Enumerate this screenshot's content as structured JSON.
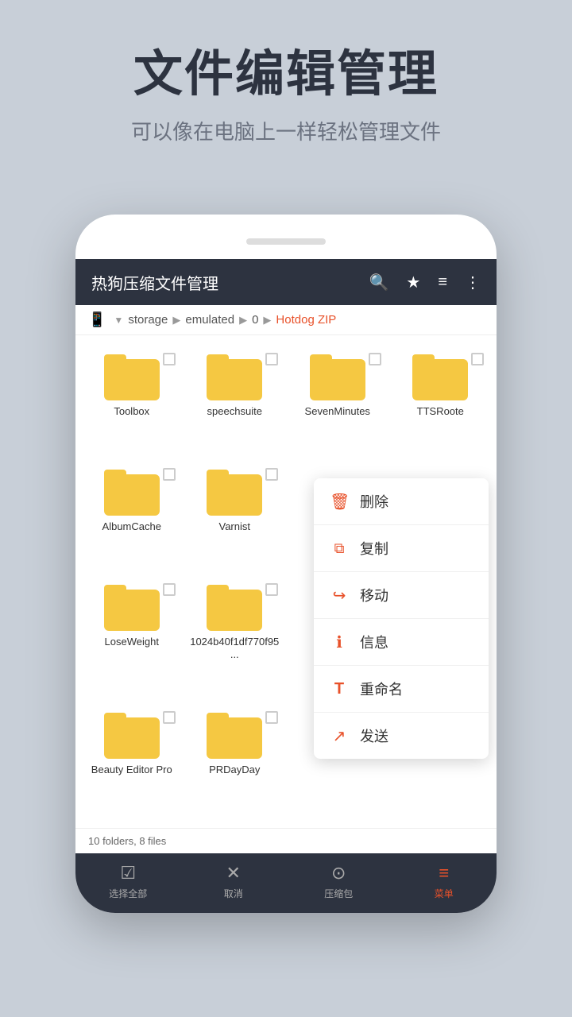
{
  "page": {
    "background": "#c8cfd8"
  },
  "header": {
    "main_title": "文件编辑管理",
    "sub_title": "可以像在电脑上一样轻松管理文件"
  },
  "appbar": {
    "title": "热狗压缩文件管理",
    "icons": [
      "search",
      "star",
      "menu",
      "more"
    ]
  },
  "breadcrumb": {
    "device": "📱",
    "path": [
      "storage",
      "emulated",
      "0"
    ],
    "highlight": "Hotdog ZIP"
  },
  "files": [
    {
      "name": "Toolbox",
      "type": "folder"
    },
    {
      "name": "speechsuite",
      "type": "folder"
    },
    {
      "name": "SevenMinutes",
      "type": "folder"
    },
    {
      "name": "TTSRoote",
      "type": "folder"
    },
    {
      "name": "AlbumCache",
      "type": "folder"
    },
    {
      "name": "Varnist",
      "type": "folder"
    },
    {
      "name": "LoseWeight",
      "type": "folder"
    },
    {
      "name": "1024b40f1df770f95...",
      "type": "folder"
    },
    {
      "name": "Beauty Editor Pro",
      "type": "folder"
    },
    {
      "name": "PRDayDay",
      "type": "folder"
    }
  ],
  "context_menu": {
    "items": [
      {
        "icon": "🗑",
        "label": "删除",
        "color": "red"
      },
      {
        "icon": "⧉",
        "label": "复制",
        "color": "orange"
      },
      {
        "icon": "⮕",
        "label": "移动",
        "color": "orange"
      },
      {
        "icon": "ℹ",
        "label": "信息",
        "color": "orange"
      },
      {
        "icon": "T",
        "label": "重命名",
        "color": "orange"
      },
      {
        "icon": "↪",
        "label": "发送",
        "color": "orange"
      }
    ]
  },
  "status_bar": {
    "text": "10 folders, 8 files"
  },
  "bottom_nav": {
    "items": [
      {
        "icon": "☑",
        "label": "选择全部",
        "active": false
      },
      {
        "icon": "✕",
        "label": "取消",
        "active": false
      },
      {
        "icon": "⊙",
        "label": "压缩包",
        "active": false
      },
      {
        "icon": "≡",
        "label": "菜单",
        "active": true
      }
    ]
  }
}
